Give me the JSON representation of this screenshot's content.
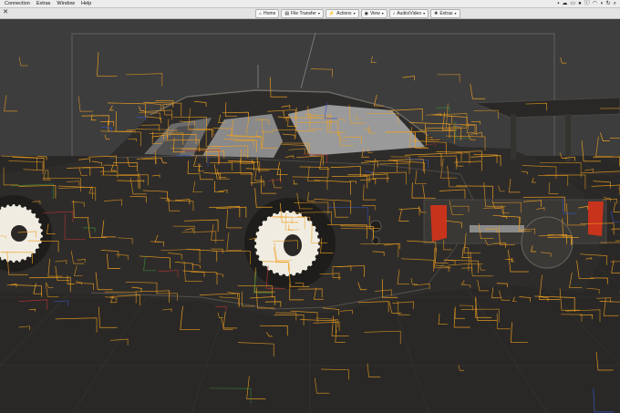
{
  "menubar": {
    "items": [
      "Connection",
      "Extras",
      "Window",
      "Help"
    ],
    "tray_icons": [
      "camera-icon",
      "cloud-icon",
      "battery-icon",
      "record-icon",
      "info-icon",
      "wifi-icon",
      "volume-icon",
      "sync-icon",
      "search-icon"
    ]
  },
  "toolbar": {
    "close_glyph": "✕",
    "buttons": [
      {
        "label": "Home",
        "icon": "home-icon",
        "glyph": "⌂",
        "dropdown": false
      },
      {
        "label": "File Transfer",
        "icon": "file-transfer-icon",
        "glyph": "▤",
        "dropdown": true
      },
      {
        "label": "Actions",
        "icon": "actions-icon",
        "glyph": "⚡",
        "dropdown": true
      },
      {
        "label": "View",
        "icon": "eye-icon",
        "glyph": "◉",
        "dropdown": true
      },
      {
        "label": "Audio/Video",
        "icon": "audio-video-icon",
        "glyph": "♪",
        "dropdown": true
      },
      {
        "label": "Extras",
        "icon": "extras-icon",
        "glyph": "✚",
        "dropdown": true
      }
    ]
  },
  "viewport": {
    "background_color": "#3d3d3d",
    "floor_color": "#2a2826",
    "car_body_color": "#2e2c2a",
    "window_color": "#8c8c8c",
    "wheel_color": "#f0ece2",
    "taillight_color": "#c8331c",
    "wireframe_color": "#f0a020"
  }
}
